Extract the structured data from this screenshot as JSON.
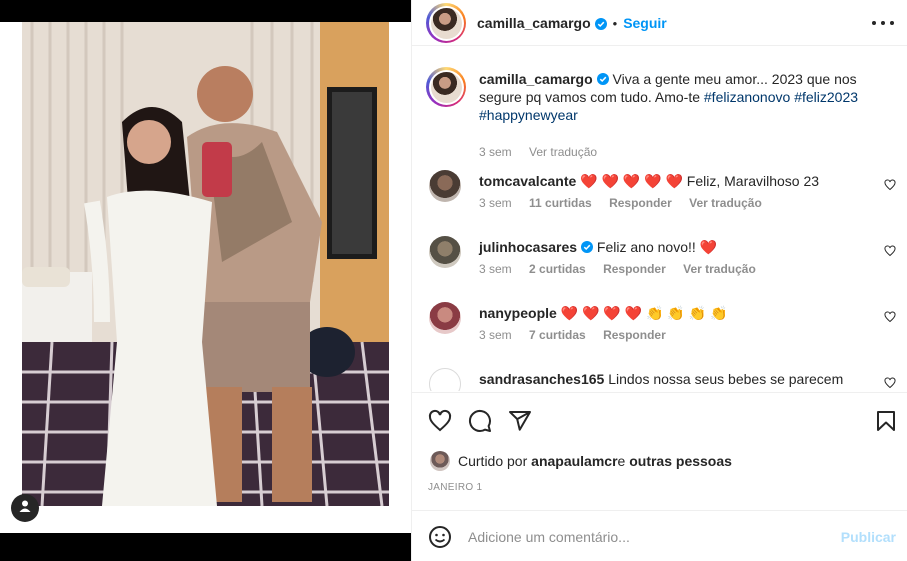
{
  "post": {
    "username": "camilla_camargo",
    "follow_label": "Seguir",
    "separator": "•"
  },
  "caption": {
    "username": "camilla_camargo",
    "text_before": " Viva a gente meu amor... 2023 que nos segure pq vamos com tudo. Amo-te ",
    "hashtags": [
      "#felizanonovo",
      "#feliz2023",
      "#happynewyear"
    ],
    "time": "3 sem",
    "translate_label": "Ver tradução"
  },
  "comments": [
    {
      "username": "tomcavalcante",
      "hearts": "❤️ ❤️ ❤️ ❤️ ❤️",
      "text": " Feliz, Maravilhoso 23",
      "time": "3 sem",
      "likes": "11 curtidas",
      "reply_label": "Responder",
      "translate_label": "Ver tradução"
    },
    {
      "username": "julinhocasares",
      "text": " Feliz ano novo!! ",
      "hearts": "❤️",
      "time": "3 sem",
      "likes": "2 curtidas",
      "reply_label": "Responder",
      "translate_label": "Ver tradução"
    },
    {
      "username": "nanypeople",
      "hearts": "❤️ ❤️ ❤️ ❤️ ",
      "claps": "👏 👏 👏 👏",
      "time": "3 sem",
      "likes": "7 curtidas",
      "reply_label": "Responder"
    },
    {
      "username": "sandrasanches165",
      "text": " Lindos nossa seus bebes se parecem muito"
    }
  ],
  "likes_row": {
    "prefix": "Curtido por ",
    "liker": "anapaulamcr",
    "middle": " e ",
    "others": "outras pessoas"
  },
  "date": "JANEIRO 1",
  "comment_box": {
    "placeholder": "Adicione um comentário...",
    "publish_label": "Publicar"
  },
  "icons": [
    "more-icon",
    "heart-icon",
    "comment-icon",
    "share-icon",
    "bookmark-icon",
    "emoji-icon",
    "verified-icon",
    "tag-user-icon"
  ],
  "colors": {
    "link_blue": "#0095f6",
    "hashtag": "#00376b",
    "muted": "#8e8e8e",
    "heart_red": "#ed4956",
    "publish_disabled": "#b2dffc"
  }
}
